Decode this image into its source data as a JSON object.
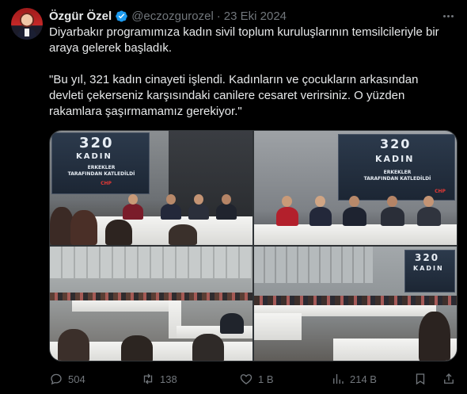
{
  "author": {
    "name": "Özgür Özel",
    "handle": "@eczozgurozel",
    "separator": "·",
    "date": "23 Eki 2024"
  },
  "tweet": {
    "line1": "Diyarbakır programımıza kadın sivil toplum kuruluşlarının temsilcileriyle bir araya gelerek başladık.",
    "line2": "\"Bu yıl, 321 kadın cinayeti işlendi. Kadınların ve çocukların arkasından devleti çekerseniz karşısındaki canilere cesaret verirsiniz. O yüzden rakamlara şaşırmamamız gerekiyor.\""
  },
  "media": {
    "screen_number": "320",
    "screen_title": "KADIN",
    "screen_sub_1": "ERKEKLER",
    "screen_sub_2": "TARAFINDAN KATLEDİLDİ",
    "screen_logo": "CHP"
  },
  "actions": {
    "replies": "504",
    "retweets": "138",
    "likes": "1 B",
    "views": "214 B"
  },
  "colors": {
    "background": "#000000",
    "text": "#e7e9ea",
    "muted": "#71767b",
    "verified": "#1d9bf0",
    "border": "#2f3336"
  },
  "icons": [
    "verified-badge-icon",
    "more-icon",
    "reply-icon",
    "retweet-icon",
    "like-icon",
    "views-icon",
    "bookmark-icon",
    "share-icon"
  ]
}
